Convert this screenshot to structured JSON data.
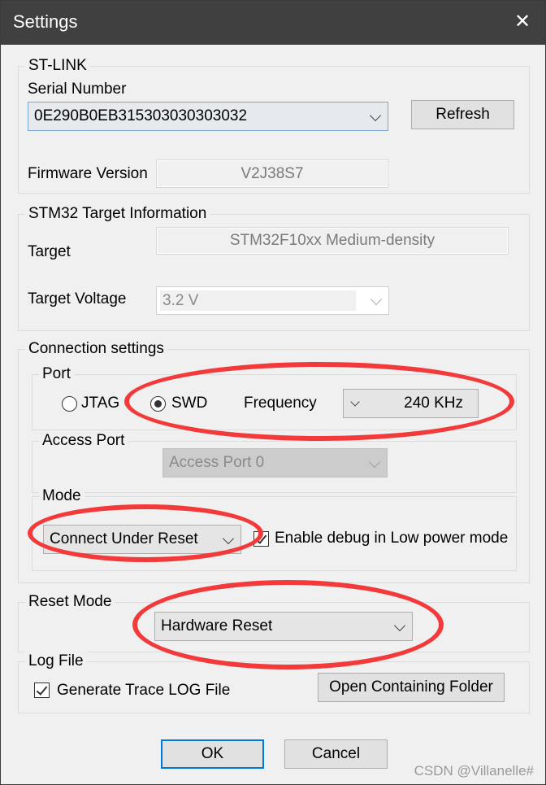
{
  "window": {
    "title": "Settings",
    "close_icon": "close-icon"
  },
  "stlink": {
    "group_label": "ST-LINK",
    "serial_label": "Serial Number",
    "serial_value": "0E290B0EB315303030303032",
    "refresh_label": "Refresh",
    "firmware_label": "Firmware Version",
    "firmware_value": "V2J38S7"
  },
  "target_info": {
    "group_label": "STM32 Target Information",
    "target_label": "Target",
    "target_value": "STM32F10xx Medium-density",
    "voltage_label": "Target Voltage",
    "voltage_value": "3.2 V"
  },
  "connection": {
    "group_label": "Connection settings",
    "port": {
      "group_label": "Port",
      "options": [
        "JTAG",
        "SWD"
      ],
      "selected": "SWD",
      "frequency_label": "Frequency",
      "frequency_value": "240 KHz"
    },
    "access_port": {
      "group_label": "Access Port",
      "value": "Access Port 0"
    },
    "mode": {
      "group_label": "Mode",
      "value": "Connect Under Reset",
      "low_power_label": "Enable debug in Low power mode",
      "low_power_checked": true
    }
  },
  "reset_mode": {
    "group_label": "Reset Mode",
    "value": "Hardware Reset"
  },
  "log_file": {
    "group_label": "Log File",
    "generate_label": "Generate Trace LOG File",
    "generate_checked": true,
    "open_folder_label": "Open Containing Folder"
  },
  "footer": {
    "ok_label": "OK",
    "cancel_label": "Cancel"
  },
  "watermark": "CSDN @Villanelle#",
  "annotation_color": "#f23a3a"
}
